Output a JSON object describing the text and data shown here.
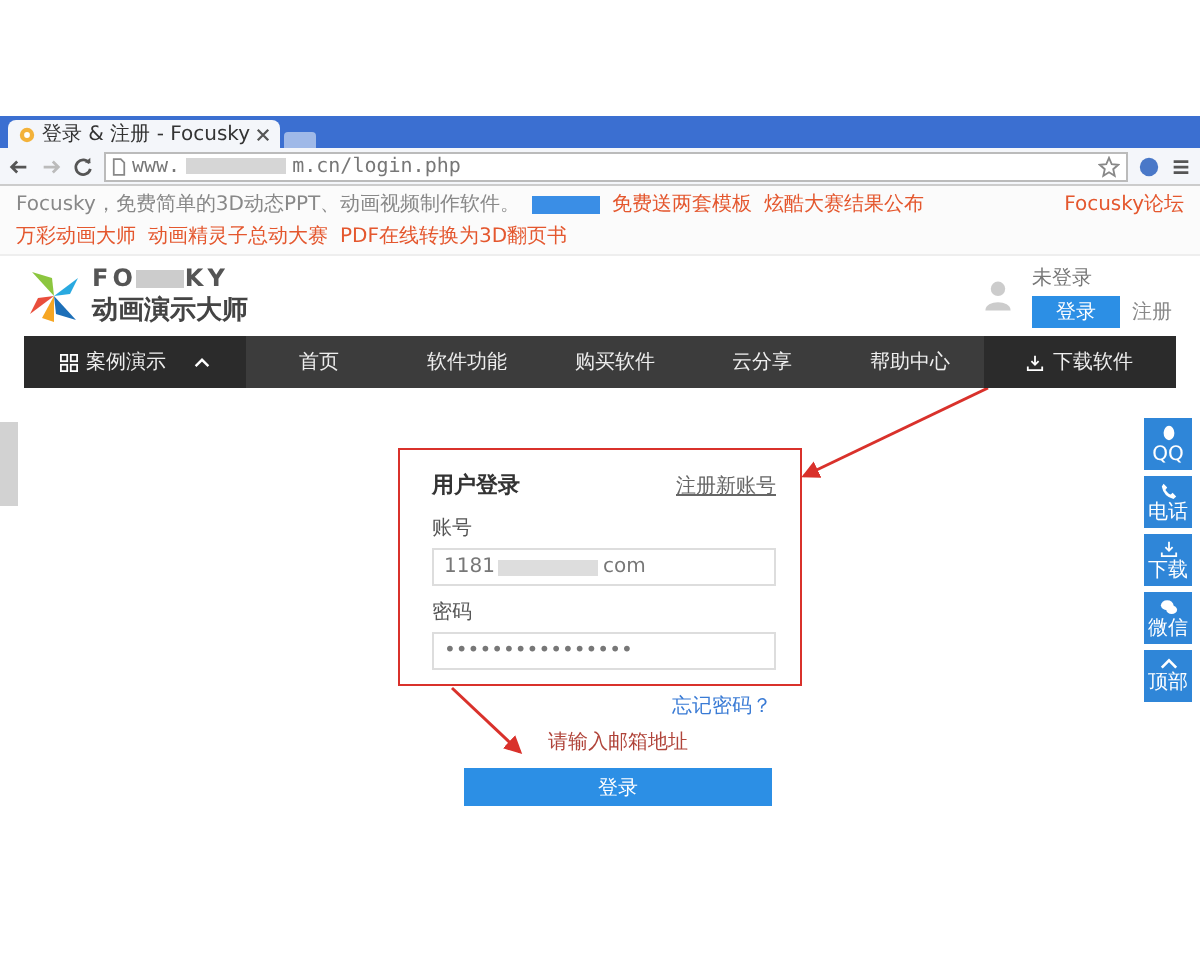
{
  "browser": {
    "tab_title": "登录 & 注册 - Focusky",
    "url_start": "www.",
    "url_end": "m.cn/login.php"
  },
  "top_strip": {
    "intro": "Focusky，免费简单的3D动态PPT、动画视频制作软件。",
    "left_links": [
      "免费送两套模板",
      "炫酷大赛结果公布"
    ],
    "right_links": [
      "Focusky论坛",
      "万彩动画大师",
      "动画精灵子总动大赛",
      "PDF在线转换为3D翻页书"
    ]
  },
  "header": {
    "logo_word_start": "FO",
    "logo_word_end": "KY",
    "logo_subtitle": "动画演示大师",
    "user_status": "未登录",
    "login_button": "登录",
    "register_link": "注册"
  },
  "nav": [
    {
      "label": "案例演示",
      "kind": "menu"
    },
    {
      "label": "首页",
      "kind": "link"
    },
    {
      "label": "软件功能",
      "kind": "link"
    },
    {
      "label": "购买软件",
      "kind": "link"
    },
    {
      "label": "云分享",
      "kind": "link"
    },
    {
      "label": "帮助中心",
      "kind": "link"
    },
    {
      "label": "下载软件",
      "kind": "download"
    }
  ],
  "login": {
    "title": "用户登录",
    "register_link": "注册新账号",
    "account_label": "账号",
    "account_value_start": "1181",
    "account_value_end": "com",
    "password_label": "密码",
    "password_value": "••••••••••••••••",
    "forgot_link": "忘记密码？",
    "error": "请输入邮箱地址",
    "submit": "登录"
  },
  "side_buttons": [
    {
      "label": "QQ",
      "kind": "qq"
    },
    {
      "label": "电话",
      "kind": "phone"
    },
    {
      "label": "下载",
      "kind": "download"
    },
    {
      "label": "微信",
      "kind": "wechat"
    },
    {
      "label": "顶部",
      "kind": "top"
    }
  ]
}
